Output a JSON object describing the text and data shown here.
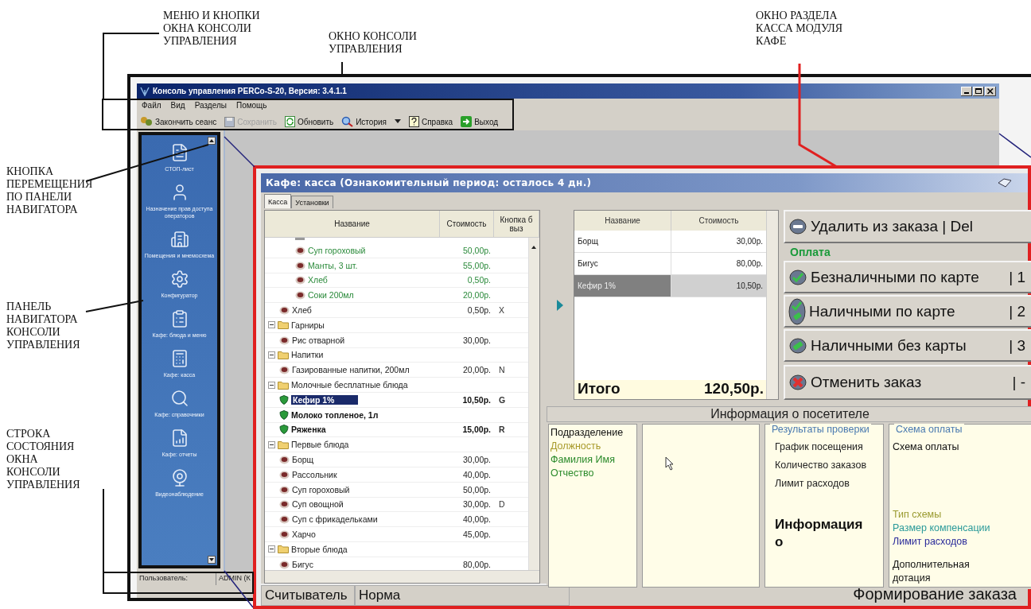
{
  "annotations": [
    {
      "text": "МЕНЮ И КНОПКИ\nОКНА КОНСОЛИ\nУПРАВЛЕНИЯ"
    },
    {
      "text": "ОКНО КОНСОЛИ\nУПРАВЛЕНИЯ"
    },
    {
      "text": "ОКНО РАЗДЕЛА\nКАССА МОДУЛЯ\nКАФЕ"
    },
    {
      "text": "КНОПКА\nПЕРЕМЕЩЕНИЯ\nПО ПАНЕЛИ\nНАВИГАТОРА"
    },
    {
      "text": "ПАНЕЛЬ\nНАВИГАТОРА\nКОНСОЛИ\nУПРАВЛЕНИЯ"
    },
    {
      "text": "СТРОКА\nСОСТОЯНИЯ\nОКНА\nКОНСОЛИ\nУПРАВЛЕНИЯ"
    }
  ],
  "console": {
    "title": "Консоль управления PERCo-S-20, Версия: 3.4.1.1",
    "menu": [
      "Файл",
      "Вид",
      "Разделы",
      "Помощь"
    ],
    "toolbar": [
      {
        "label": "Закончить сеанс",
        "disabled": false,
        "has_menu": false
      },
      {
        "label": "Сохранить",
        "disabled": true,
        "has_menu": false
      },
      {
        "label": "Обновить",
        "disabled": false,
        "has_menu": false
      },
      {
        "label": "История",
        "disabled": false,
        "has_menu": true
      },
      {
        "label": "Справка",
        "disabled": false,
        "has_menu": false
      },
      {
        "label": "Выход",
        "disabled": false,
        "has_menu": false
      }
    ],
    "navigator": [
      "СТОП-лист",
      "Назначение прав доступа операторов",
      "Помещения и мнемосхема",
      "Конфигуратор",
      "Кафе: блюда и меню",
      "Кафе: касса",
      "Кафе: справочники",
      "Кафе: отчеты",
      "Видеонаблюдение"
    ],
    "status_bar": {
      "label": "Пользователь:",
      "value": "ADMIN (К"
    }
  },
  "cafe": {
    "title": "Кафе: касса (Ознакомительный период: осталось 4 дн.)",
    "tabs": [
      {
        "label": "Касса",
        "selected": true
      },
      {
        "label": "Установки",
        "selected": false
      }
    ],
    "menu_columns": [
      "Название",
      "Стоимость",
      "Кнопка б\nвыз"
    ],
    "tree": [
      {
        "kind": "folder-cut",
        "children": [
          {
            "kind": "set-cut",
            "children": [
              {
                "kind": "set-dish",
                "name": "Суп гороховый",
                "price": "50,00р.",
                "selected": false
              },
              {
                "kind": "set-dish",
                "name": "Манты, 3 шт.",
                "price": "55,00р.",
                "selected": false
              },
              {
                "kind": "set-dish",
                "name": "Хлеб",
                "price": "0,50р.",
                "selected": false
              },
              {
                "kind": "set-dish",
                "name": "Соки 200мл",
                "price": "20,00р.",
                "selected": false
              }
            ]
          },
          {
            "kind": "dish",
            "name": "Хлеб",
            "price": "0,50р.",
            "key": "X",
            "selected": false
          }
        ]
      },
      {
        "kind": "folder",
        "name": "Гарниры",
        "expanded": true,
        "children": [
          {
            "kind": "dish",
            "name": "Рис отварной",
            "price": "30,00р.",
            "selected": false
          }
        ]
      },
      {
        "kind": "folder",
        "name": "Напитки",
        "expanded": true,
        "children": [
          {
            "kind": "dish",
            "name": "Газированные напитки, 200мл",
            "price": "20,00р.",
            "key": "N",
            "selected": false
          }
        ]
      },
      {
        "kind": "folder",
        "name": "Молочные бесплатные блюда",
        "expanded": true,
        "children": [
          {
            "kind": "free-dish",
            "name": "Кефир 1%",
            "price": "10,50р.",
            "key": "G",
            "selected": true
          },
          {
            "kind": "free-dish",
            "name": "Молоко топленое, 1л",
            "selected": false
          },
          {
            "kind": "free-dish",
            "name": "Ряженка",
            "price": "15,00р.",
            "key": "R",
            "selected": false
          }
        ]
      },
      {
        "kind": "folder",
        "name": "Первые блюда",
        "expanded": true,
        "children": [
          {
            "kind": "dish",
            "name": "Борщ",
            "price": "30,00р.",
            "selected": false
          },
          {
            "kind": "dish",
            "name": "Рассольник",
            "price": "40,00р.",
            "selected": false
          },
          {
            "kind": "dish",
            "name": "Суп гороховый",
            "price": "50,00р.",
            "selected": false
          },
          {
            "kind": "dish",
            "name": "Суп овощной",
            "price": "30,00р.",
            "key": "D",
            "selected": false
          },
          {
            "kind": "dish",
            "name": "Суп с фрикадельками",
            "price": "40,00р.",
            "selected": false
          },
          {
            "kind": "dish",
            "name": "Харчо",
            "price": "45,00р.",
            "selected": false
          }
        ]
      },
      {
        "kind": "folder",
        "name": "Вторые блюда",
        "expanded": true,
        "children": [
          {
            "kind": "dish",
            "name": "Бигус",
            "price": "80,00р.",
            "selected": false
          }
        ]
      }
    ],
    "order": {
      "columns": [
        "Название",
        "Стоимость"
      ],
      "rows": [
        {
          "name": "Борщ",
          "price": "30,00р.",
          "selected": false
        },
        {
          "name": "Бигус",
          "price": "80,00р.",
          "selected": false
        },
        {
          "name": "Кефир 1%",
          "price": "10,50р.",
          "selected": true
        }
      ],
      "total_label": "Итого",
      "total": "120,50р."
    },
    "actions": {
      "delete": {
        "label": "Удалить из заказа",
        "key": "| Del"
      },
      "payment_title": "Оплата",
      "payments": [
        {
          "label": "Безналичными по карте",
          "key": "| 1"
        },
        {
          "label": "Наличными по карте",
          "key": "| 2"
        },
        {
          "label": "Наличными без карты",
          "key": "| 3"
        }
      ],
      "cancel": {
        "label": "Отменить заказ",
        "key": "| -"
      }
    },
    "visitor": {
      "title": "Информация о посетителе",
      "fields": [
        {
          "label": "Подразделение",
          "color": "#101010"
        },
        {
          "label": "Должность",
          "color": "#a89a2a"
        },
        {
          "label": "Фамилия Имя",
          "color": "#2a8a2a"
        },
        {
          "label": "Отчество",
          "color": "#2a8a2a"
        }
      ],
      "checks_title": "Результаты проверки",
      "checks": [
        "График посещения",
        "Количество заказов",
        "Лимит расходов"
      ],
      "info_text": "Информация о",
      "scheme_title": "Схема оплаты",
      "scheme": [
        {
          "label": "Схема оплаты",
          "color": "#101010"
        },
        {
          "label": "Тип схемы",
          "color": "#9a9a30"
        },
        {
          "label": "Размер компенсации",
          "color": "#2a9a9a"
        },
        {
          "label": "Лимит расходов",
          "color": "#2a2a9a"
        },
        {
          "label": "Дополнительная дотация",
          "color": "#101010"
        }
      ]
    },
    "status": {
      "reader_label": "Считыватель",
      "reader_value": "Норма",
      "mode": "Формирование заказа"
    }
  }
}
